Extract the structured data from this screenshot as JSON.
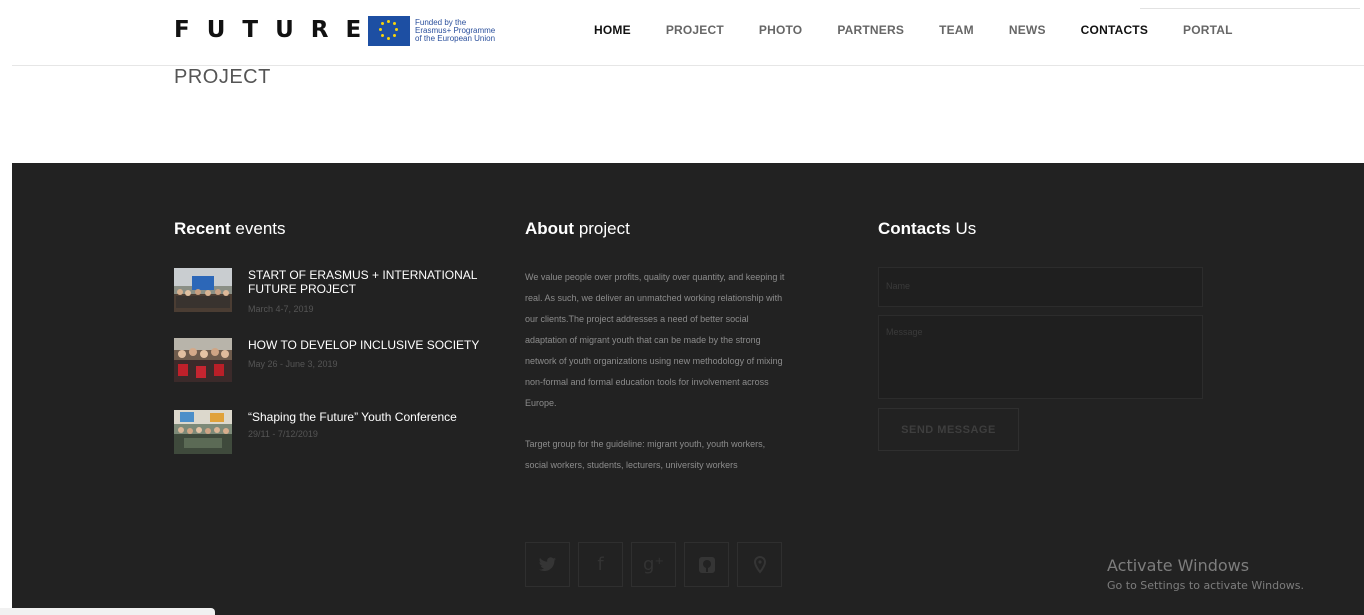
{
  "header": {
    "logo": "FUTURE",
    "eu_badge_lines": [
      "Funded by the",
      "Erasmus+ Programme",
      "of the European Union"
    ],
    "nav": [
      {
        "label": "HOME",
        "active": true
      },
      {
        "label": "PROJECT",
        "active": false
      },
      {
        "label": "PHOTO",
        "active": false
      },
      {
        "label": "PARTNERS",
        "active": false
      },
      {
        "label": "TEAM",
        "active": false
      },
      {
        "label": "NEWS",
        "active": false
      },
      {
        "label": "CONTACTS",
        "active": true
      },
      {
        "label": "PORTAL",
        "active": false
      }
    ]
  },
  "page_title": "PROJECT",
  "footer": {
    "recent": {
      "title_bold": "Recent",
      "title_rest": " events",
      "items": [
        {
          "title": "START OF ERASMUS + INTERNATIONAL FUTURE PROJECT",
          "date": "March 4-7, 2019"
        },
        {
          "title": "HOW TO DEVELOP INCLUSIVE SOCIETY",
          "date": "May 26 - June 3, 2019"
        },
        {
          "title": "“Shaping the Future” Youth Conference",
          "date": "29/11 - 7/12/2019"
        }
      ]
    },
    "about": {
      "title_bold": "About",
      "title_rest": " project",
      "paragraphs": [
        "We value people over profits, quality over quantity, and keeping it real. As such, we deliver an unmatched working relationship with our clients.The project addresses a need of better social adaptation of migrant youth that can be made by the strong network of youth organizations using new methodology of mixing non-formal and formal education tools for involvement across Europe.",
        "Target group for the guideline: migrant youth, youth workers, social workers, students, lecturers, university workers"
      ]
    },
    "socials": [
      {
        "icon": "twitter-icon",
        "glyph": "🐦"
      },
      {
        "icon": "facebook-icon",
        "glyph": "f"
      },
      {
        "icon": "google-plus-icon",
        "glyph": "g⁺"
      },
      {
        "icon": "pinterest-icon",
        "glyph": "℗"
      },
      {
        "icon": "location-pin-icon",
        "glyph": "⚲"
      }
    ],
    "contacts": {
      "title_bold": "Contacts",
      "title_rest": " Us",
      "name_placeholder": "Name",
      "message_placeholder": "Message",
      "send_label": "SEND MESSAGE"
    }
  },
  "watermark": {
    "line1": "Activate Windows",
    "line2": "Go to Settings to activate Windows."
  }
}
